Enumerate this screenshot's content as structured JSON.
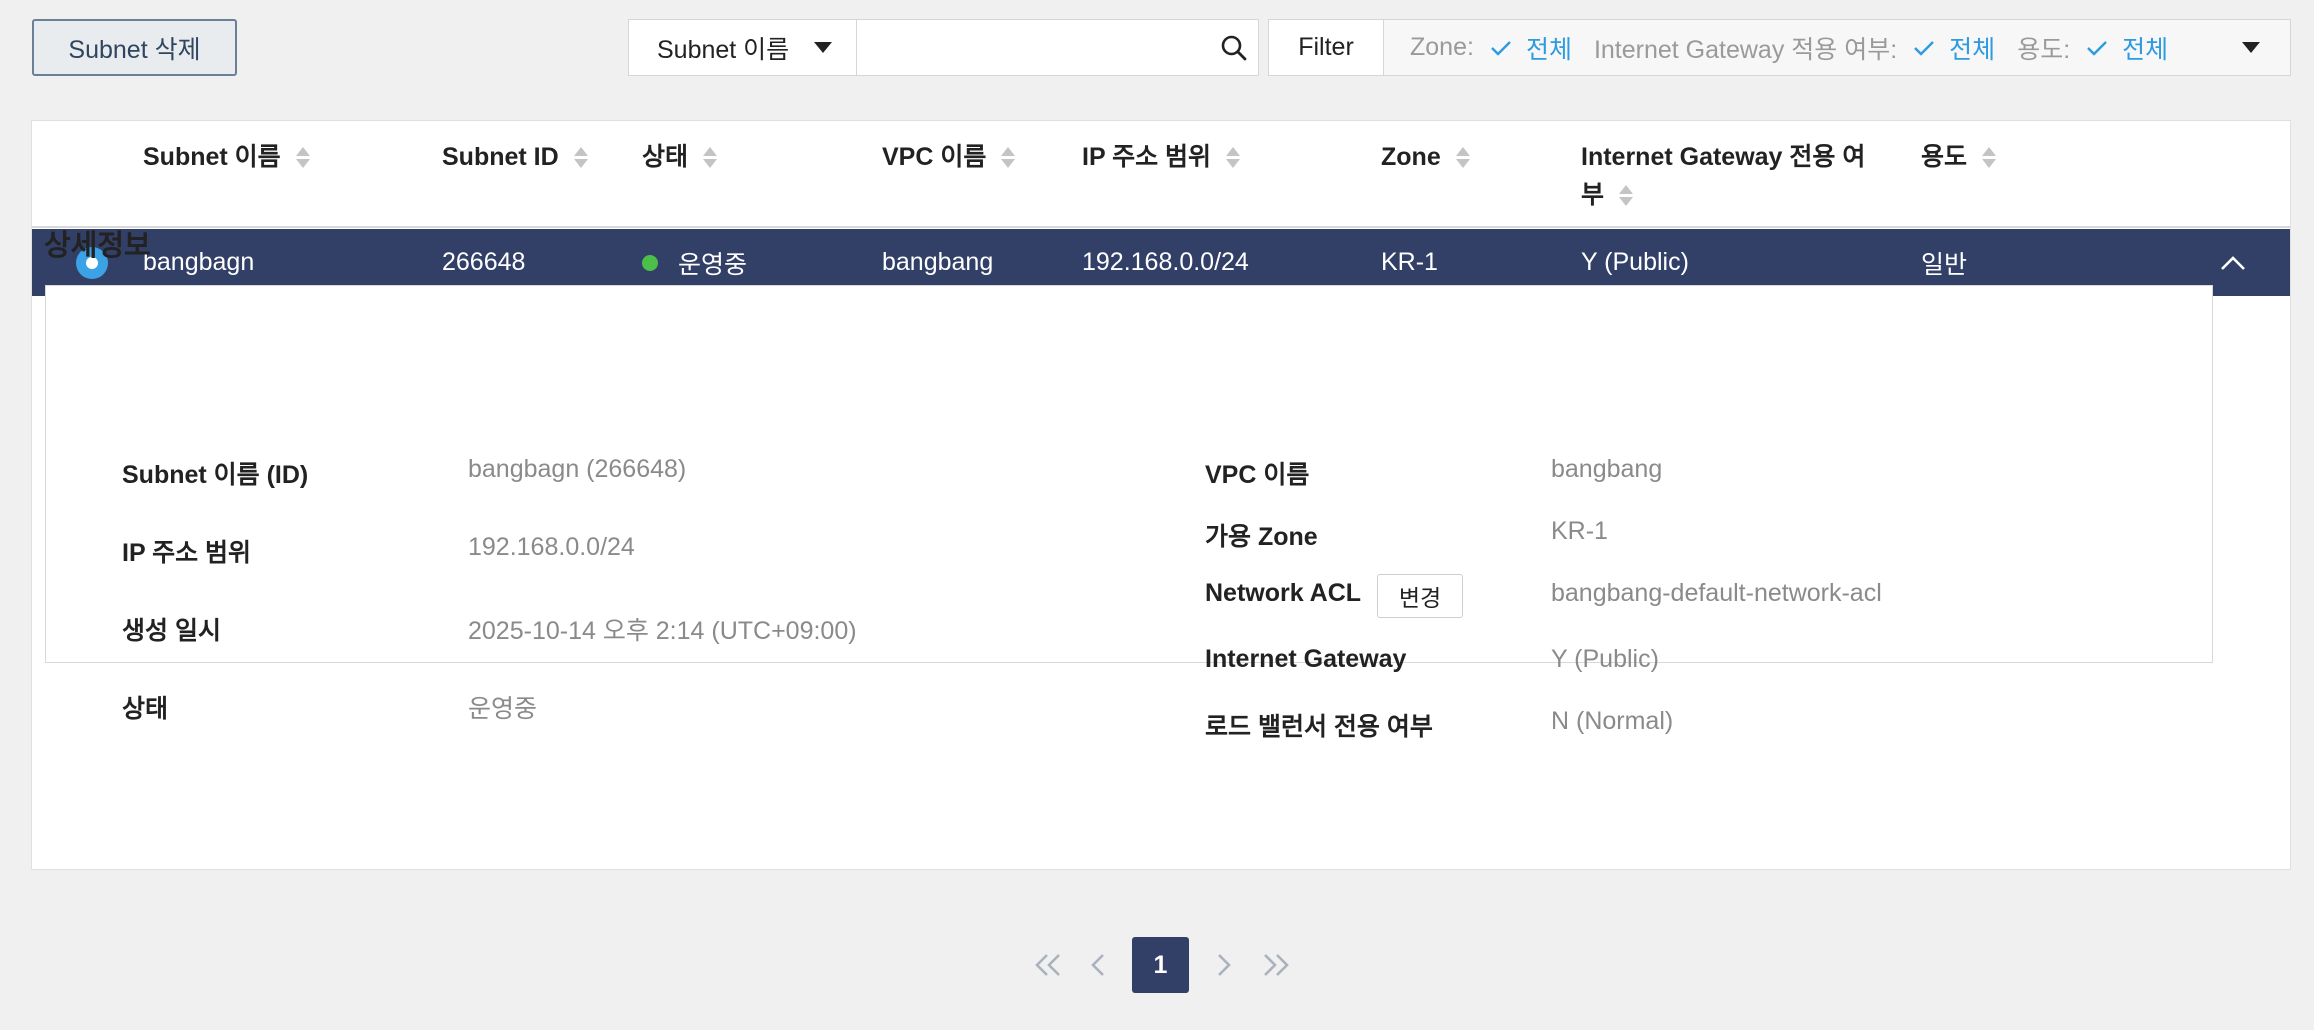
{
  "toolbar": {
    "delete_label": "Subnet 삭제",
    "search_field_selected": "Subnet 이름",
    "search_value": "",
    "filter_label": "Filter",
    "filters": [
      {
        "label": "Zone:",
        "value": "전체"
      },
      {
        "label": "Internet Gateway 적용 여부:",
        "value": "전체"
      },
      {
        "label": "용도:",
        "value": "전체"
      }
    ]
  },
  "table": {
    "columns": [
      {
        "label": "Subnet 이름"
      },
      {
        "label": "Subnet ID"
      },
      {
        "label": "상태"
      },
      {
        "label": "VPC 이름"
      },
      {
        "label": "IP 주소 범위"
      },
      {
        "label": "Zone"
      },
      {
        "label": "Internet Gateway 전용 여",
        "label2": "부"
      },
      {
        "label": "용도"
      }
    ],
    "rows": [
      {
        "name": "bangbagn",
        "id": "266648",
        "status": "운영중",
        "vpc": "bangbang",
        "ip_range": "192.168.0.0/24",
        "zone": "KR-1",
        "igw": "Y (Public)",
        "usage": "일반"
      }
    ]
  },
  "detail": {
    "title": "상세정보",
    "left": [
      {
        "label": "Subnet 이름 (ID)",
        "value": "bangbagn (266648)"
      },
      {
        "label": "IP 주소 범위",
        "value": "192.168.0.0/24"
      },
      {
        "label": "생성 일시",
        "value": "2025-10-14 오후 2:14 (UTC+09:00)"
      },
      {
        "label": "상태",
        "value": "운영중"
      }
    ],
    "right": [
      {
        "label": "VPC 이름",
        "value": "bangbang"
      },
      {
        "label": "가용 Zone",
        "value": "KR-1"
      },
      {
        "label": "Network ACL",
        "value": "bangbang-default-network-acl"
      },
      {
        "label": "Internet Gateway",
        "value": "Y (Public)"
      },
      {
        "label": "로드 밸런서 전용 여부",
        "value": "N (Normal)"
      }
    ],
    "change_button": "변경"
  },
  "pagination": {
    "current_page": "1"
  },
  "colors": {
    "selected_row": "#324068",
    "accent": "#2d9be0",
    "status_running": "#4cbf4a"
  }
}
